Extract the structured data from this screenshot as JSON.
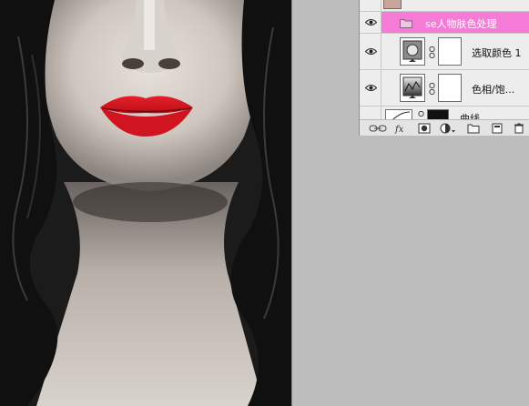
{
  "layers": {
    "group_name": "se人物肤色处理",
    "selective_color_label": "选取颜色 1",
    "hue_sat_label": "色相/饱...",
    "partial_label": "曲线"
  },
  "footer_icons": [
    "link-icon",
    "fx-icon",
    "mask-icon",
    "adjustment-icon",
    "folder-icon",
    "new-layer-icon",
    "trash-icon"
  ],
  "colors": {
    "group_highlight": "#f57bd6",
    "lip_red": "#d8121c",
    "workspace": "#bdbdbd"
  }
}
